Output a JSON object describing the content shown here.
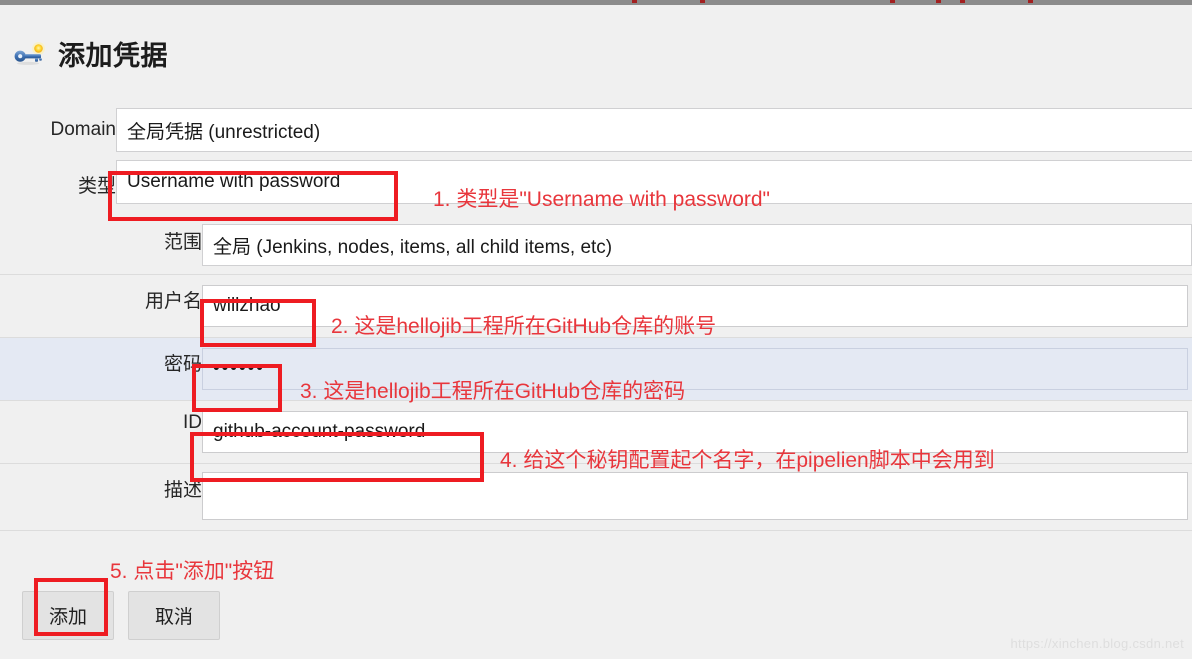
{
  "heading": {
    "icon": "key-icon",
    "title": "添加凭据"
  },
  "form": {
    "domain": {
      "label": "Domain",
      "value": "全局凭据 (unrestricted)",
      "control": "select"
    },
    "kind": {
      "label": "类型",
      "value": "Username with password",
      "control": "select"
    },
    "scope": {
      "label": "范围",
      "value": "全局 (Jenkins, nodes, items, all child items, etc)",
      "control": "select"
    },
    "username": {
      "label": "用户名",
      "value": "willzhao",
      "placeholder": "",
      "control": "text"
    },
    "password": {
      "label": "密码",
      "value": "••••••",
      "placeholder": "",
      "control": "password"
    },
    "id": {
      "label": "ID",
      "value": "github-account-password",
      "placeholder": "",
      "control": "text"
    },
    "description": {
      "label": "描述",
      "value": "",
      "placeholder": "",
      "control": "textarea"
    }
  },
  "buttons": {
    "submit": "添加",
    "cancel": "取消"
  },
  "annotations": [
    {
      "id": "note-1",
      "text": "1. 类型是\"Username with password\""
    },
    {
      "id": "note-2",
      "text": "2. 这是hellojib工程所在GitHub仓库的账号"
    },
    {
      "id": "note-3",
      "text": "3. 这是hellojib工程所在GitHub仓库的密码"
    },
    {
      "id": "note-4",
      "text": "4. 给这个秘钥配置起个名字，在pipelien脚本中会用到"
    },
    {
      "id": "note-5",
      "text": "5. 点击\"添加\"按钮"
    }
  ],
  "watermark": "https://xinchen.blog.csdn.net",
  "colors": {
    "annotation_red": "#e8363c",
    "highlight_box_red": "#ee1c22",
    "page_background": "#f0f0f0",
    "highlight_row": "#e4e9f3"
  }
}
